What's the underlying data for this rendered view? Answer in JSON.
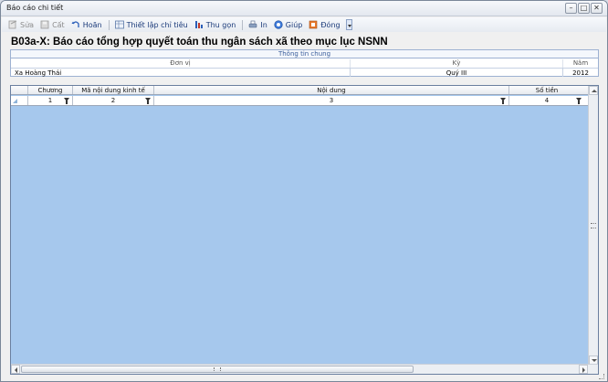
{
  "window": {
    "title": "Báo cáo chi tiết",
    "controls": [
      {
        "name": "minimize",
        "glyph": "–"
      },
      {
        "name": "maximize",
        "glyph": "□"
      },
      {
        "name": "close",
        "glyph": "✕"
      }
    ]
  },
  "toolbar": {
    "items": [
      {
        "key": "sua",
        "label": "Sửa",
        "icon": "edit-icon",
        "disabled": true
      },
      {
        "key": "cat",
        "label": "Cất",
        "icon": "save-icon",
        "disabled": true
      },
      {
        "key": "hoan",
        "label": "Hoãn",
        "icon": "undo-icon",
        "disabled": false
      },
      {
        "key": "thiet_lap",
        "label": "Thiết lập chỉ tiêu",
        "icon": "settings-table-icon",
        "disabled": false
      },
      {
        "key": "thu_gon",
        "label": "Thu gọn",
        "icon": "collapse-icon",
        "disabled": false
      },
      {
        "key": "in",
        "label": "In",
        "icon": "printer-icon",
        "disabled": false
      },
      {
        "key": "giup",
        "label": "Giúp",
        "icon": "help-icon",
        "disabled": false
      },
      {
        "key": "dong",
        "label": "Đóng",
        "icon": "close-door-icon",
        "disabled": false
      }
    ]
  },
  "report": {
    "title": "B03a-X: Báo cáo tổng hợp quyết toán thu ngân sách xã theo mục lục NSNN"
  },
  "info": {
    "caption": "Thông tin chung",
    "headers": {
      "don_vi": "Đơn vị",
      "ky": "Kỳ",
      "nam": "Năm"
    },
    "values": {
      "don_vi": "Xa Hoàng Thái",
      "ky": "Quý III",
      "nam": "2012"
    }
  },
  "grid": {
    "columns": [
      "Chương",
      "Mã nội dung kinh tế",
      "Nội dung",
      "Số tiền"
    ],
    "filter_row": [
      "1",
      "2",
      "3",
      "4"
    ]
  },
  "colors": {
    "grid_background": "#a6c8ed",
    "toolbar_text": "#1b3b7a",
    "border": "#9db1d2"
  }
}
